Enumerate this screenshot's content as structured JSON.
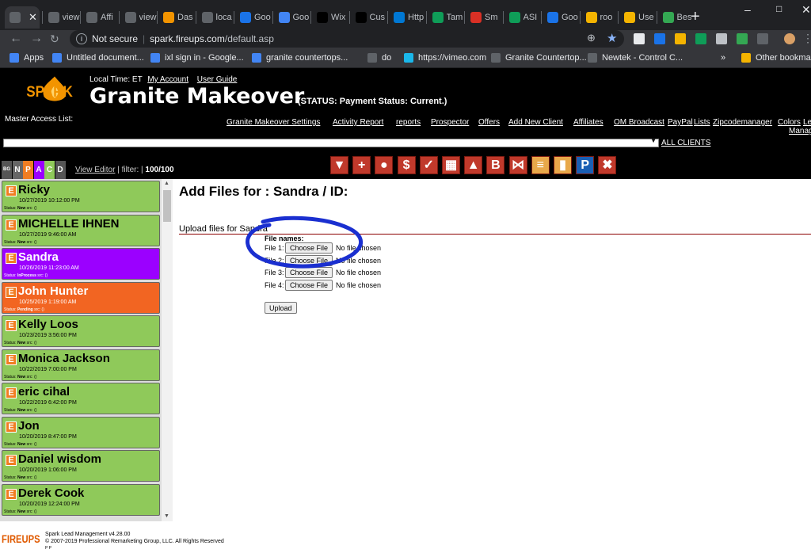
{
  "browser": {
    "tabs": [
      {
        "title": "",
        "icon": "globe-icon",
        "active": true
      },
      {
        "title": "view",
        "icon": "globe-icon"
      },
      {
        "title": "Affi",
        "icon": "globe-icon"
      },
      {
        "title": "view",
        "icon": "globe-icon"
      },
      {
        "title": "Das",
        "icon": "flame-icon"
      },
      {
        "title": "loca",
        "icon": "globe-icon"
      },
      {
        "title": "Goo",
        "icon": "calendar-icon"
      },
      {
        "title": "Goo",
        "icon": "google-icon"
      },
      {
        "title": "Wix",
        "icon": "wix-icon"
      },
      {
        "title": "Cus",
        "icon": "wix-icon"
      },
      {
        "title": "Http",
        "icon": "windows-icon"
      },
      {
        "title": "Tam",
        "icon": "sheet-icon"
      },
      {
        "title": "Sm",
        "icon": "arrow-icon"
      },
      {
        "title": "ASI",
        "icon": "asi-icon"
      },
      {
        "title": "Goo",
        "icon": "calendar-icon"
      },
      {
        "title": "roo",
        "icon": "mail-icon"
      },
      {
        "title": "Use",
        "icon": "mail-icon"
      },
      {
        "title": "Bes",
        "icon": "maps-icon"
      }
    ],
    "not_secure": "Not secure",
    "url_host": "spark.fireups.com",
    "url_path": "/default.asp",
    "bookmarks": [
      {
        "label": "Apps",
        "icon": "apps-icon"
      },
      {
        "label": "Untitled document...",
        "icon": "docs-icon"
      },
      {
        "label": "ixl sign in - Google...",
        "icon": "google-icon"
      },
      {
        "label": "granite countertops...",
        "icon": "google-icon"
      },
      {
        "label": "do",
        "icon": "globe-icon"
      },
      {
        "label": "https://vimeo.com",
        "icon": "vimeo-icon"
      },
      {
        "label": "Granite Countertop...",
        "icon": "globe-icon"
      },
      {
        "label": "Newtek - Control C...",
        "icon": "globe-icon"
      }
    ],
    "more_bookmarks": "»",
    "other_bookmarks": "Other bookmarks"
  },
  "header": {
    "logo_text": "SPARK",
    "local_time_label": "Local Time:",
    "local_time_zone": "ET",
    "my_account": "My Account",
    "user_guide": "User Guide",
    "title": "Granite Makeover",
    "status": "(STATUS: Payment Status: Current.)",
    "master_access": "Master Access List:",
    "nav": [
      "Granite Makeover Settings",
      "Activity Report",
      "reports",
      "Prospector",
      "Offers",
      "Add New Client",
      "Affiliates",
      "OM Broadcast",
      "PayPal",
      "Lists",
      "Zipcodemanager",
      "Colors",
      "Le"
    ],
    "nav_wrap": "Manag",
    "all_clients": "ALL CLIENTS"
  },
  "filterbar": {
    "letters": [
      "BG",
      "N",
      "P",
      "A",
      "C",
      "D"
    ],
    "view_editor": "View Editor",
    "filter_label": "| filter: |",
    "count": "100/100",
    "tool_icons": [
      "filter-icon",
      "plus-icon",
      "circle-icon",
      "dollar-icon",
      "check-icon",
      "grid-icon",
      "person-icon",
      "b-icon",
      "bowtie-icon",
      "list-icon",
      "truck-icon",
      "paypal-icon",
      "x-icon"
    ]
  },
  "clients": [
    {
      "name": "Ricky",
      "date": "10/27/2019 10:12:00 PM",
      "status": "New",
      "color": "#8fc95a"
    },
    {
      "name": "MICHELLE IHNEN",
      "date": "10/27/2019 9:46:00 AM",
      "status": "New",
      "color": "#8fc95a"
    },
    {
      "name": "Sandra",
      "date": "10/26/2019 11:23:00 AM",
      "status": "InProcess",
      "color": "#9b00ff"
    },
    {
      "name": "John Hunter",
      "date": "10/25/2019 1:19:00 AM",
      "status": "Pending",
      "color": "#f26522"
    },
    {
      "name": "Kelly Loos",
      "date": "10/23/2019 3:56:00 PM",
      "status": "New",
      "color": "#8fc95a"
    },
    {
      "name": "Monica Jackson",
      "date": "10/22/2019 7:00:00 PM",
      "status": "New",
      "color": "#8fc95a"
    },
    {
      "name": "eric cihal",
      "date": "10/22/2019 6:42:00 PM",
      "status": "New",
      "color": "#8fc95a"
    },
    {
      "name": "Jon",
      "date": "10/20/2019 8:47:00 PM",
      "status": "New",
      "color": "#8fc95a"
    },
    {
      "name": "Daniel wisdom",
      "date": "10/20/2019 1:06:00 PM",
      "status": "New",
      "color": "#8fc95a"
    },
    {
      "name": "Derek Cook",
      "date": "10/20/2019 12:24:00 PM",
      "status": "New",
      "color": "#8fc95a"
    }
  ],
  "client_status_prefix": "Status:",
  "client_src": "src: ()",
  "main": {
    "title": "Add Files for : Sandra / ID:",
    "upload_heading": "Upload files for Sandra",
    "file_names_label": "File names:",
    "files": [
      {
        "label": "File 1:",
        "button": "Choose File",
        "value": "No file chosen"
      },
      {
        "label": "File 2:",
        "button": "Choose File",
        "value": "No file chosen"
      },
      {
        "label": "File 3:",
        "button": "Choose File",
        "value": "No file chosen"
      },
      {
        "label": "File 4:",
        "button": "Choose File",
        "value": "No file chosen"
      }
    ],
    "upload_button": "Upload"
  },
  "footer": {
    "logo": "FIREUPS",
    "version": "Spark Lead Management v4.28.00",
    "copyright": "© 2007-2019 Professional Remarketing Group, LLC. All Rights Reserved",
    "small": "P P"
  }
}
